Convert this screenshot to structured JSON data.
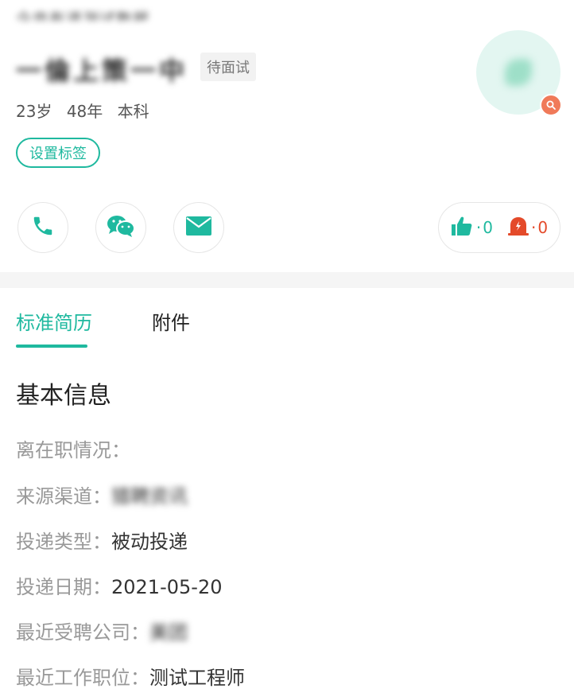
{
  "header": {
    "breadcrumb": "企亩有道测试数据",
    "candidate_name": "一倫上策一中",
    "status_badge": "待面试",
    "age": "23岁",
    "experience": "48年",
    "education": "本科",
    "set_tag_label": "设置标签"
  },
  "contact": {
    "phone_icon": "phone-icon",
    "wechat_icon": "wechat-icon",
    "email_icon": "mail-icon"
  },
  "stats": {
    "likes_prefix": "·",
    "likes": "0",
    "alerts_prefix": "·",
    "alerts": "0"
  },
  "tabs": [
    {
      "label": "标准简历",
      "active": true
    },
    {
      "label": "附件",
      "active": false
    }
  ],
  "section": {
    "title": "基本信息"
  },
  "fields": [
    {
      "label": "离在职情况：",
      "value": ""
    },
    {
      "label": "来源渠道：",
      "value": "猎聘资讯"
    },
    {
      "label": "投递类型：",
      "value": "被动投递"
    },
    {
      "label": "投递日期：",
      "value": "2021-05-20"
    },
    {
      "label": "最近受聘公司：",
      "value": "美团"
    },
    {
      "label": "最近工作职位：",
      "value": "测试工程师"
    }
  ],
  "colors": {
    "accent": "#1fb99f",
    "alert": "#e44a2a",
    "avatar_bg": "#e3f6f1"
  }
}
